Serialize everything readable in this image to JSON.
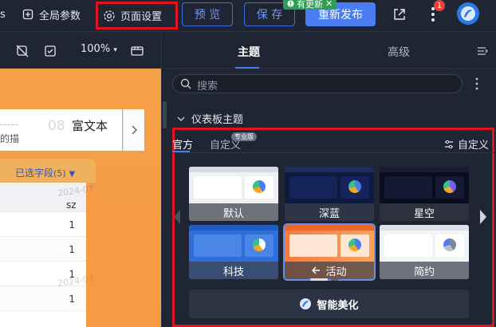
{
  "topbar": {
    "left_fragment": "s",
    "global_params": "全局参数",
    "page_settings": "页面设置",
    "preview": "预 览",
    "save": "保 存",
    "publish": "重新发布",
    "update_badge": "有更新",
    "notify_count": "1"
  },
  "canvas": {
    "zoom": "100%",
    "rich_text_num": "08",
    "rich_text_label": "富文本",
    "rich_text_desc": "的描",
    "fields_label": "已选字段",
    "fields_count": "(5)",
    "col_header": "sz",
    "rows": [
      "1",
      "1",
      "1",
      "1"
    ],
    "watermark": "2024-07"
  },
  "panel": {
    "tab_theme": "主题",
    "tab_advanced": "高级",
    "search_placeholder": "搜索",
    "section_title": "仪表板主题",
    "subtab_official": "官方",
    "subtab_custom": "自定义",
    "pro_badge": "专业版",
    "custom_link": "自定义",
    "themes": [
      {
        "name": "默认"
      },
      {
        "name": "深蓝"
      },
      {
        "name": "星空"
      },
      {
        "name": "科技"
      },
      {
        "name": "活动"
      },
      {
        "name": "简约"
      }
    ],
    "beautify": "智能美化"
  },
  "colors": {
    "accent": "#4b7df2",
    "highlight_box": "#e0141e",
    "update_green": "#2f9d55",
    "canvas_orange": "#f59b43"
  }
}
